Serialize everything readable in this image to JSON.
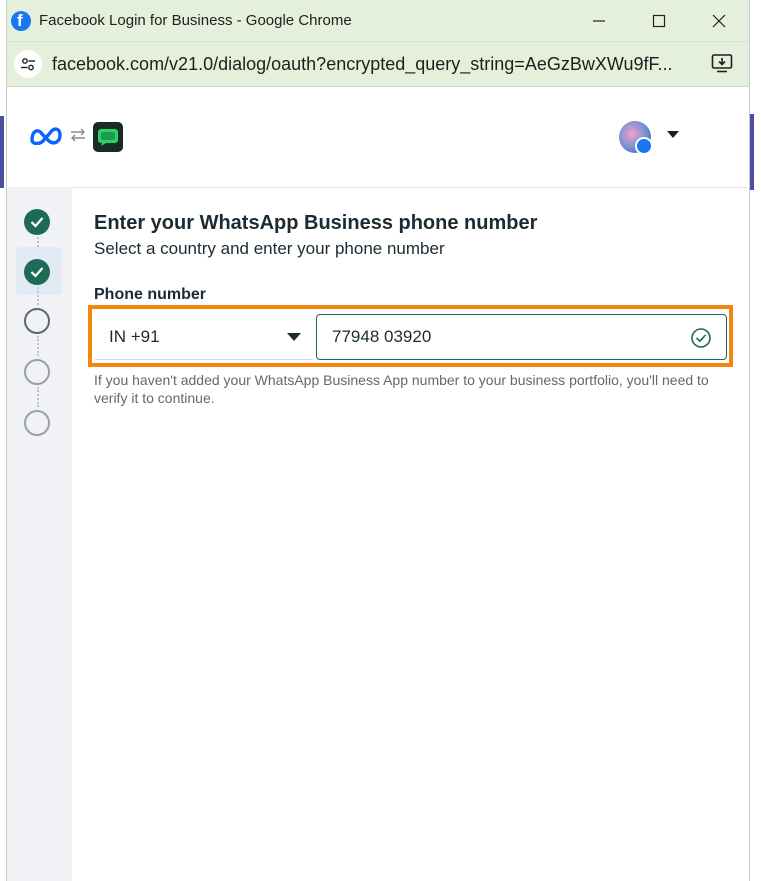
{
  "window": {
    "title": "Facebook Login for Business - Google Chrome",
    "url": "facebook.com/v21.0/dialog/oauth?encrypted_query_string=AeGzBwXWu9fF..."
  },
  "colors": {
    "titlebar": "#e4f0dc",
    "accent_green": "#1d6b57",
    "highlight_orange": "#f5870f",
    "facebook_blue": "#1877f2"
  },
  "header": {
    "icons": [
      "meta-logo-icon",
      "swap-arrows-icon",
      "whatsapp-app-icon",
      "account-avatar",
      "caret-down-icon"
    ]
  },
  "steps": [
    {
      "state": "done"
    },
    {
      "state": "done",
      "active": true
    },
    {
      "state": "todo"
    },
    {
      "state": "todo"
    },
    {
      "state": "todo"
    }
  ],
  "form": {
    "heading": "Enter your WhatsApp Business phone number",
    "subheading": "Select a country and enter your phone number",
    "phone_label": "Phone number",
    "country_value": "IN +91",
    "phone_value": "77948 03920",
    "helper_text": "If you haven't added your WhatsApp Business App number to your business portfolio, you'll need to verify it to continue."
  }
}
